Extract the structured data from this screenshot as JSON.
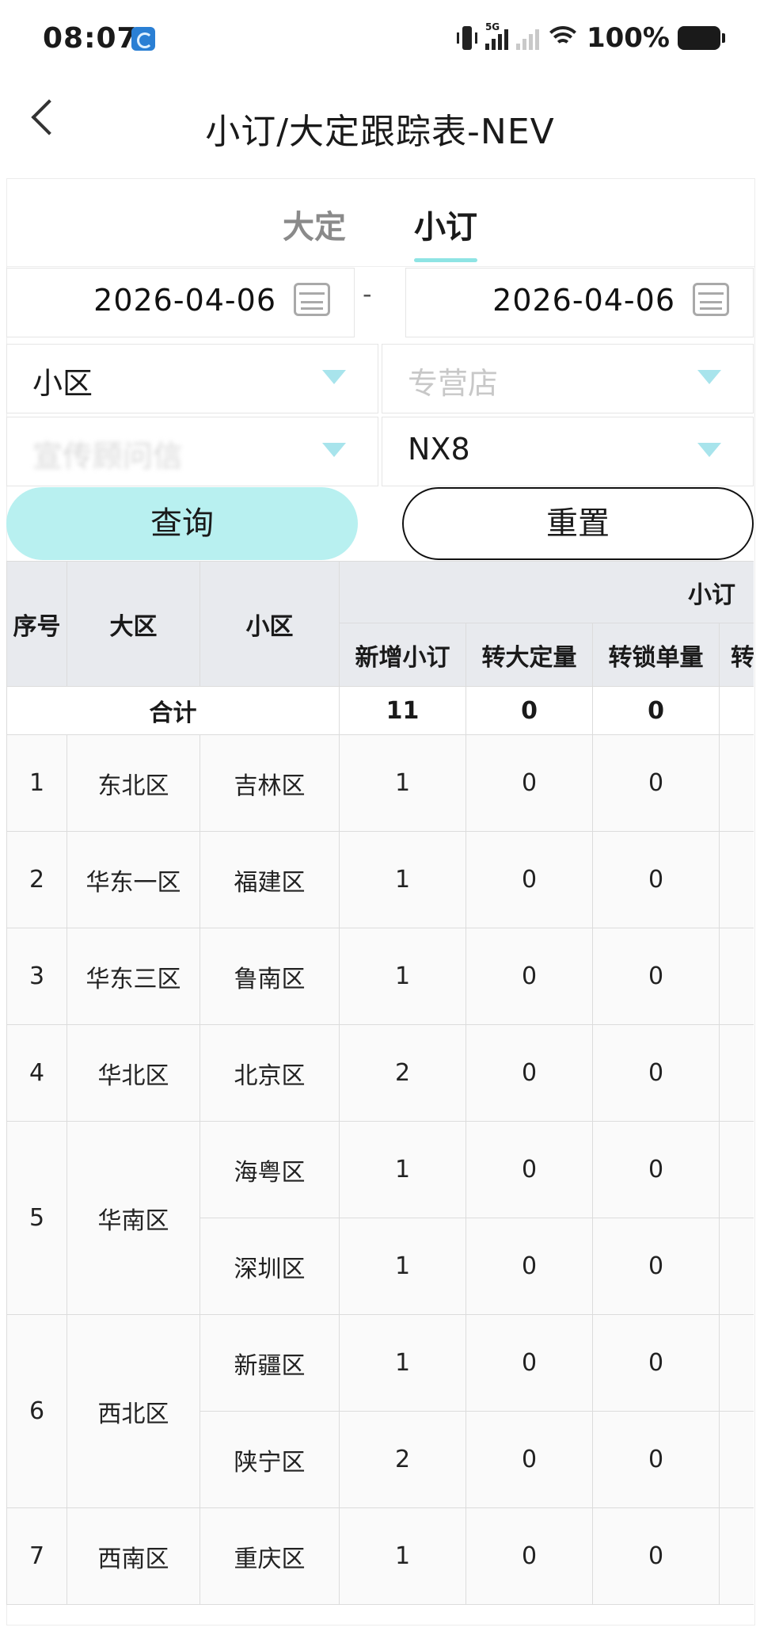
{
  "status_bar": {
    "time": "08:07",
    "network_label": "5G",
    "battery": "100%"
  },
  "header": {
    "title": "小订/大定跟踪表-NEV"
  },
  "tabs": [
    {
      "label": "大定"
    },
    {
      "label": "小订"
    }
  ],
  "filters": {
    "date_from": "2026-04-06",
    "date_separator": "-",
    "date_to": "2026-04-06",
    "region_label": "小区",
    "store_placeholder": "专营店",
    "blurred_field": "宣传顾问信",
    "model_value": "NX8"
  },
  "buttons": {
    "query": "查询",
    "reset": "重置"
  },
  "table": {
    "headers": {
      "index": "序号",
      "big_region": "大区",
      "small_region": "小区",
      "group": "小订"
    },
    "subheaders": [
      "新增小订",
      "转大定量",
      "转锁单量",
      "转"
    ],
    "total": {
      "label": "合计",
      "new_orders": "11",
      "to_deposit": "0",
      "to_lock": "0"
    },
    "groups": [
      {
        "index": "1",
        "big_region": "东北区",
        "rows": [
          {
            "small_region": "吉林区",
            "values": [
              "1",
              "0",
              "0"
            ]
          }
        ]
      },
      {
        "index": "2",
        "big_region": "华东一区",
        "rows": [
          {
            "small_region": "福建区",
            "values": [
              "1",
              "0",
              "0"
            ]
          }
        ]
      },
      {
        "index": "3",
        "big_region": "华东三区",
        "rows": [
          {
            "small_region": "鲁南区",
            "values": [
              "1",
              "0",
              "0"
            ]
          }
        ]
      },
      {
        "index": "4",
        "big_region": "华北区",
        "rows": [
          {
            "small_region": "北京区",
            "values": [
              "2",
              "0",
              "0"
            ]
          }
        ]
      },
      {
        "index": "5",
        "big_region": "华南区",
        "rows": [
          {
            "small_region": "海粤区",
            "values": [
              "1",
              "0",
              "0"
            ]
          },
          {
            "small_region": "深圳区",
            "values": [
              "1",
              "0",
              "0"
            ]
          }
        ]
      },
      {
        "index": "6",
        "big_region": "西北区",
        "rows": [
          {
            "small_region": "新疆区",
            "values": [
              "1",
              "0",
              "0"
            ]
          },
          {
            "small_region": "陕宁区",
            "values": [
              "2",
              "0",
              "0"
            ]
          }
        ]
      },
      {
        "index": "7",
        "big_region": "西南区",
        "rows": [
          {
            "small_region": "重庆区",
            "values": [
              "1",
              "0",
              "0"
            ]
          }
        ]
      }
    ]
  }
}
